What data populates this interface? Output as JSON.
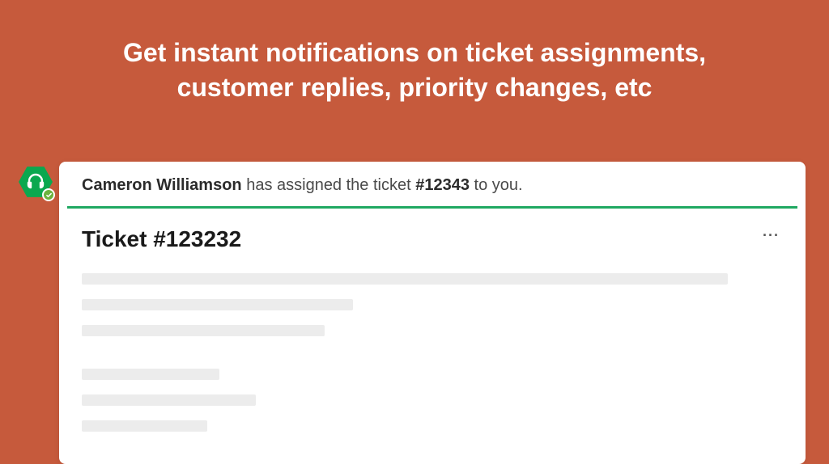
{
  "hero": {
    "line1": "Get instant notifications on ticket assignments,",
    "line2": "customer replies, priority changes, etc"
  },
  "notification": {
    "actor": "Cameron Williamson",
    "action_prefix": " has assigned the ticket ",
    "ticket_ref": "#12343",
    "action_suffix": " to you."
  },
  "ticket": {
    "title": "Ticket #123232"
  },
  "icons": {
    "app_badge": "headset-icon",
    "status": "check-icon",
    "more": "···"
  },
  "colors": {
    "background": "#c65a3c",
    "brand_green": "#0aa84f",
    "divider_green": "#1fa861",
    "skeleton": "#ececec"
  }
}
